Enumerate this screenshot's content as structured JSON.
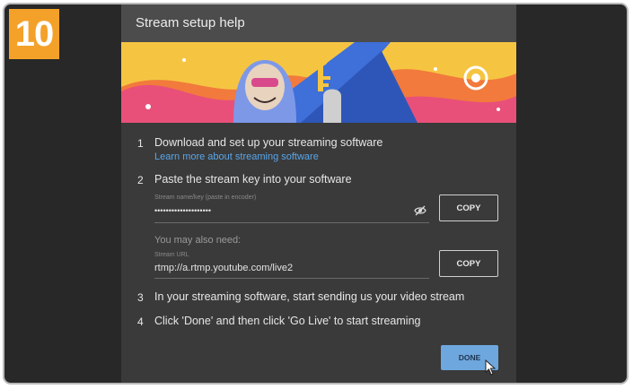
{
  "step_badge": "10",
  "dialog": {
    "title": "Stream setup help",
    "steps": [
      {
        "num": "1",
        "text": "Download and set up your streaming software",
        "link": "Learn more about streaming software"
      },
      {
        "num": "2",
        "text": "Paste the stream key into your software"
      },
      {
        "num": "3",
        "text": "In your streaming software, start sending us your video stream"
      },
      {
        "num": "4",
        "text": "Click 'Done' and then click 'Go Live' to start streaming"
      }
    ],
    "stream_key": {
      "label": "Stream name/key (paste in encoder)",
      "value": "••••••••••••••••••••",
      "copy_label": "COPY"
    },
    "also_need": "You may also need:",
    "stream_url": {
      "label": "Stream URL",
      "value": "rtmp://a.rtmp.youtube.com/live2",
      "copy_label": "COPY"
    },
    "done_label": "DONE"
  },
  "colors": {
    "badge": "#f4a12a",
    "dialog_bg": "#3a3a3a",
    "header_bg": "#4c4c4c",
    "link": "#5aa6e8",
    "done_bg": "#6ea7de"
  },
  "icons": [
    "eye-off-icon",
    "mouse-pointer-icon"
  ]
}
